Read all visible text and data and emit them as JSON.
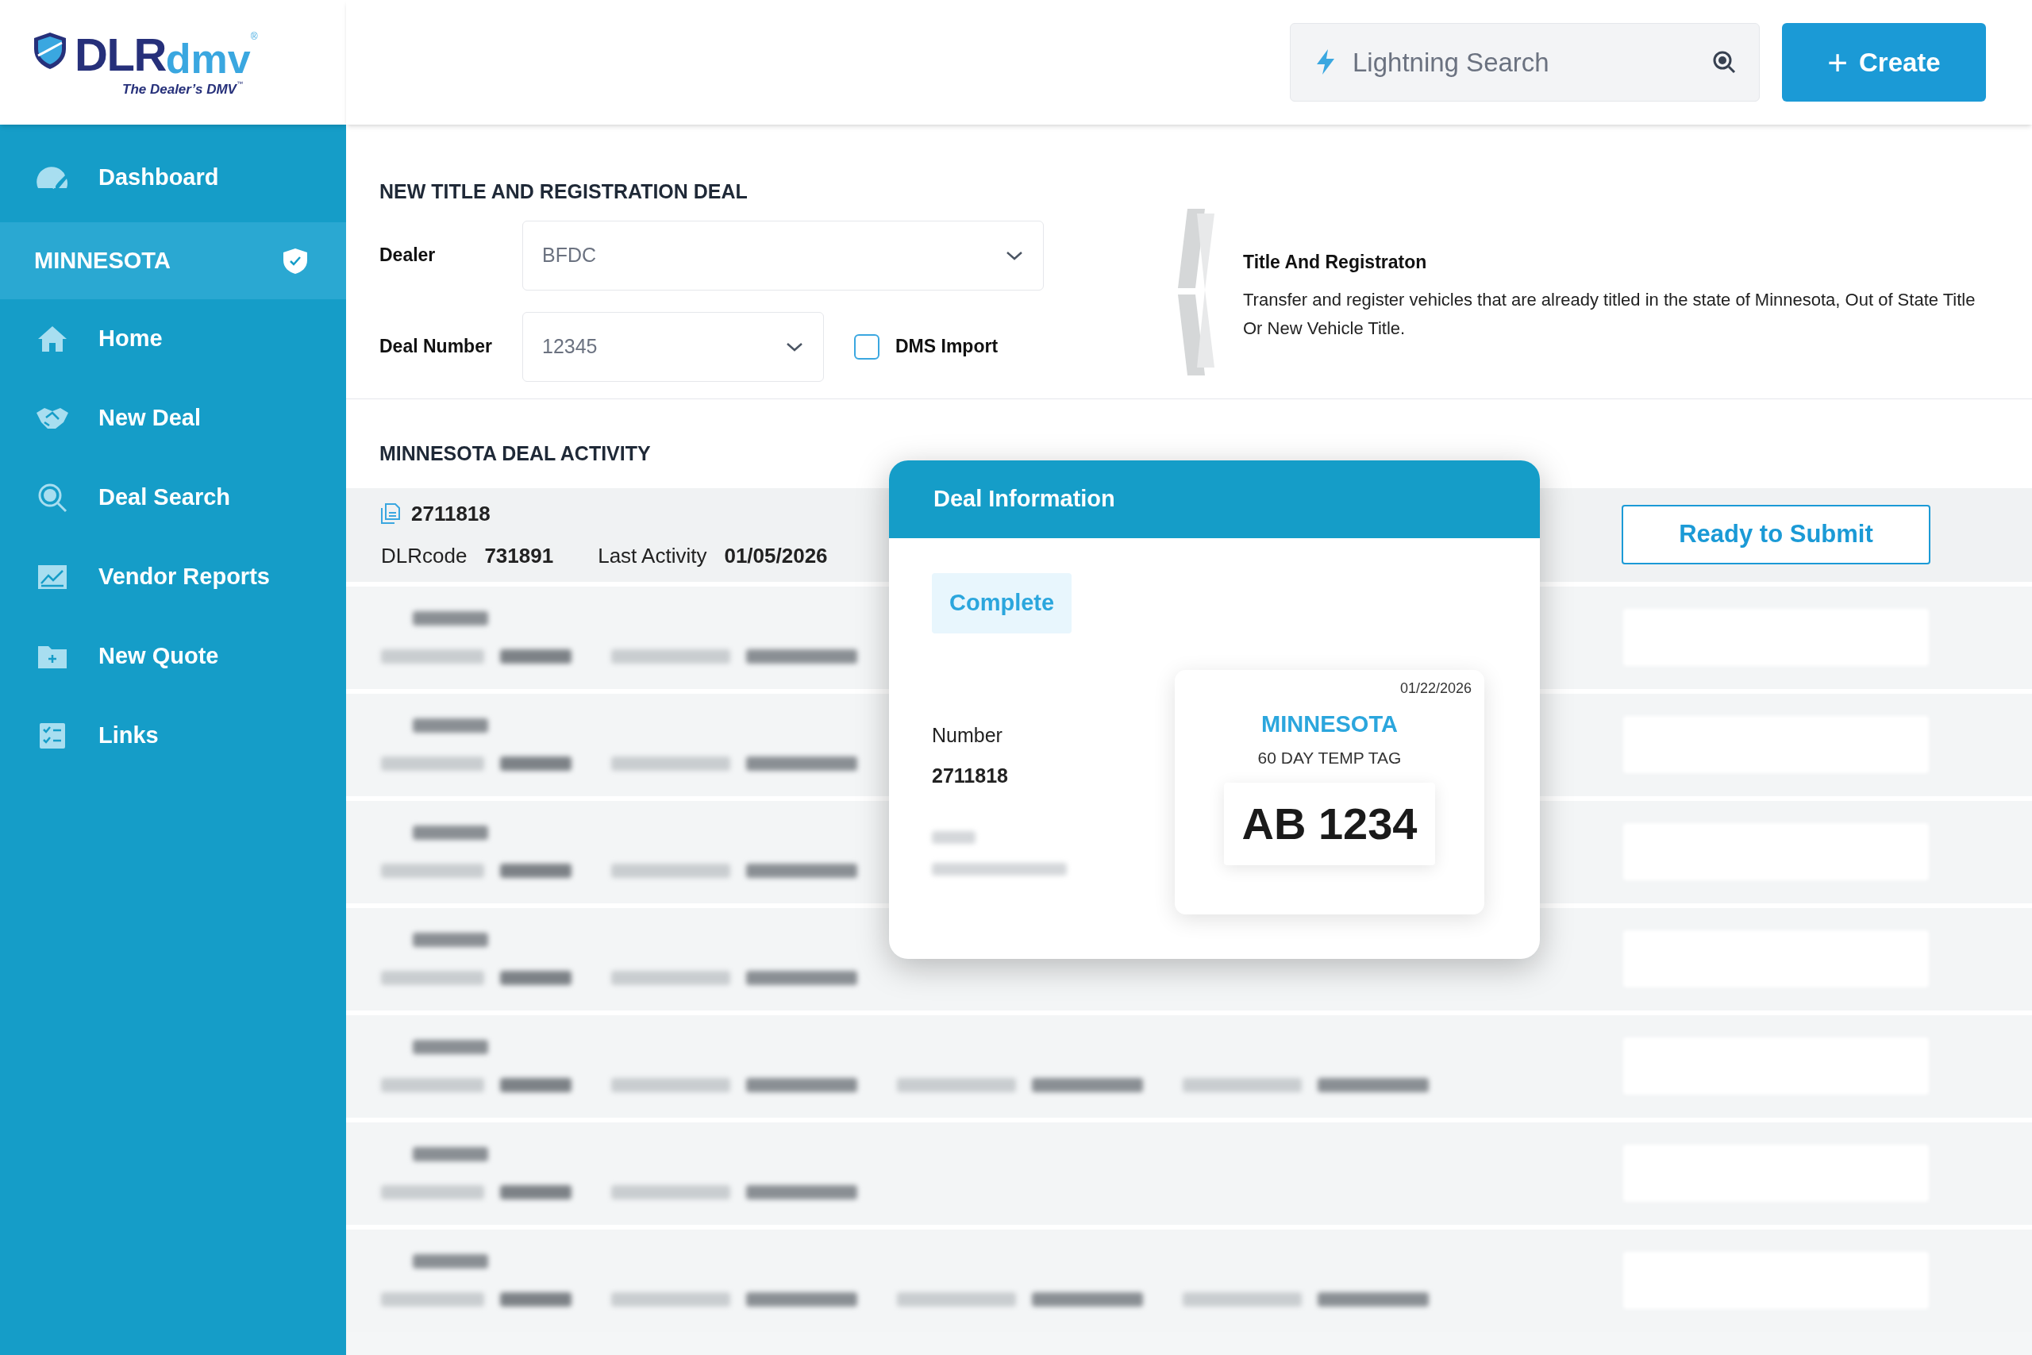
{
  "logo": {
    "brand": "DLR",
    "brand_accent": "dmv",
    "registered": "®",
    "tagline": "The Dealer’s DMV",
    "trademark": "™"
  },
  "header": {
    "search": {
      "placeholder": "Lightning Search"
    },
    "create_button": {
      "icon": "+",
      "label": "Create"
    }
  },
  "sidebar": {
    "items": [
      {
        "kind": "link",
        "label": "Dashboard",
        "selected": false
      },
      {
        "kind": "state",
        "label": "MINNESOTA",
        "selected": true
      },
      {
        "kind": "link",
        "label": "Home",
        "selected": false
      },
      {
        "kind": "link",
        "label": "New Deal",
        "selected": false
      },
      {
        "kind": "link",
        "label": "Deal Search",
        "selected": false
      },
      {
        "kind": "link",
        "label": "Vendor Reports",
        "selected": false
      },
      {
        "kind": "link",
        "label": "New Quote",
        "selected": false
      },
      {
        "kind": "link",
        "label": "Links",
        "selected": false
      }
    ]
  },
  "new_deal": {
    "title": "NEW TITLE AND REGISTRATION DEAL",
    "dealer": {
      "label": "Dealer",
      "value": "BFDC"
    },
    "deal_number": {
      "label": "Deal Number",
      "value": "12345"
    },
    "dms_import": {
      "label": "DMS Import",
      "checked": false
    },
    "info": {
      "title": "Title And Registraton",
      "text": "Transfer and register vehicles that are already titled in the state of Minnesota, Out of State Title Or New Vehicle Title."
    }
  },
  "activity": {
    "title": "MINNESOTA DEAL ACTIVITY",
    "row": {
      "number": "2711818",
      "code_label": "DLRcode",
      "code": "731891",
      "activity_label": "Last Activity",
      "activity_date": "01/05/2026",
      "button": "Ready to Submit"
    }
  },
  "deal_info": {
    "title": "Deal Information",
    "status": "Complete",
    "number_label": "Number",
    "number": "2711818",
    "plate": {
      "date": "01/22/2026",
      "state": "MINNESOTA",
      "type": "60 DAY TEMP TAG",
      "number": "AB 1234"
    }
  }
}
